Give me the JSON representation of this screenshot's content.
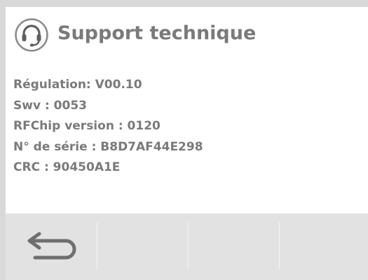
{
  "header": {
    "title": "Support technique",
    "icon": "headset-icon"
  },
  "info": {
    "lines": [
      "Régulation: V00.10",
      "Swv : 0053",
      "RFChip version : 0120",
      "N° de série : B8D7AF44E298",
      "CRC : 90450A1E"
    ]
  },
  "toolbar": {
    "back_icon": "back-arrow-icon"
  },
  "colors": {
    "text": "#7a7a7a",
    "toolbar_bg": "#e2e2e2",
    "frame_bg": "#d9d9d9",
    "icon": "#6f6f6f"
  }
}
